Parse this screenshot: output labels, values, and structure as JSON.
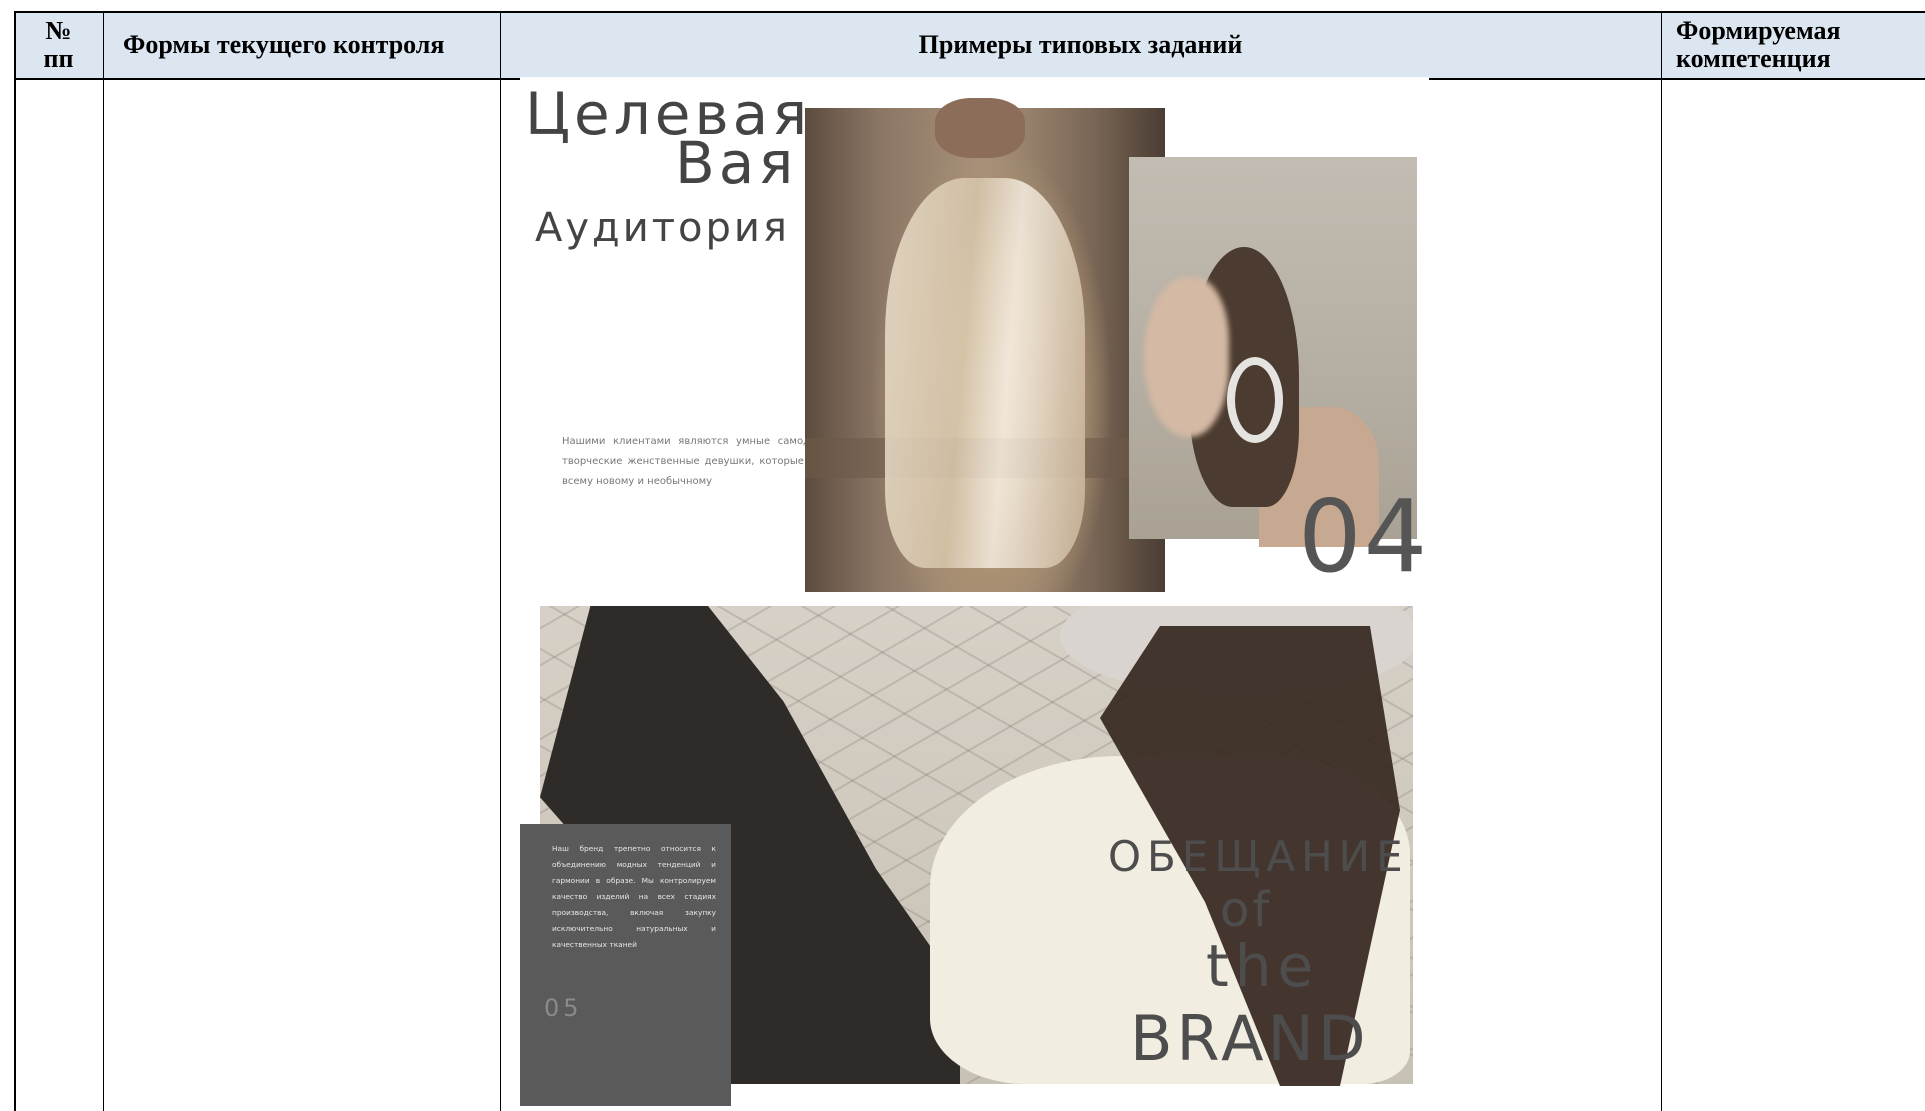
{
  "table": {
    "headers": {
      "num_line1": "№",
      "num_line2": "пп",
      "forms": "Формы текущего контроля",
      "examples": "Примеры типовых заданий",
      "competence_line1": "Формируемая",
      "competence_line2": "компетенция"
    }
  },
  "slide1": {
    "title_line1": "Целевая",
    "title_line2": "Вая",
    "title_line3": "Аудитория",
    "body": "Нашими клиентами являются умные самодостаточные творческие женственные девушки, которые открыты ко всему новому и необычному",
    "number": "04"
  },
  "slide2": {
    "box_text": "Наш бренд трепетно относится к объединению модных тенденций и гармонии в образе. Мы контролируем качество изделий на всех стадиях производства, включая закупку исключительно натуральных и качественных тканей",
    "number": "05",
    "brand_line1": "ОБЕЩАНИЕ",
    "brand_line2": "of",
    "brand_line3": "the",
    "brand_line4": "BRAND"
  }
}
